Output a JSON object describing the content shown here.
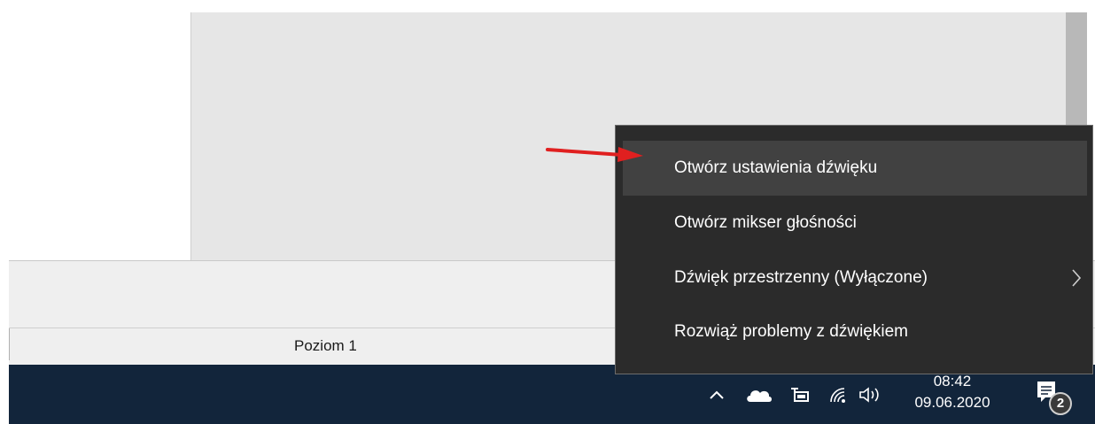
{
  "status_bar": {
    "level_label": "Poziom 1"
  },
  "context_menu": {
    "items": [
      {
        "label": "Otwórz ustawienia dźwięku",
        "highlighted": true
      },
      {
        "label": "Otwórz mikser głośności"
      },
      {
        "label": "Dźwięk przestrzenny (Wyłączone)",
        "has_submenu": true
      },
      {
        "label": "Rozwiąż problemy z dźwiękiem"
      }
    ]
  },
  "taskbar": {
    "tray_icons": [
      "chevron-up-icon",
      "onedrive-cloud-icon",
      "battery-power-icon",
      "wifi-icon",
      "volume-icon"
    ],
    "time": "08:42",
    "date": "09.06.2020",
    "notification_count": "2"
  },
  "colors": {
    "taskbar": "#12253b",
    "menu_background": "#2b2b2b",
    "menu_highlight": "#414141",
    "annotation_arrow": "#e02020"
  }
}
